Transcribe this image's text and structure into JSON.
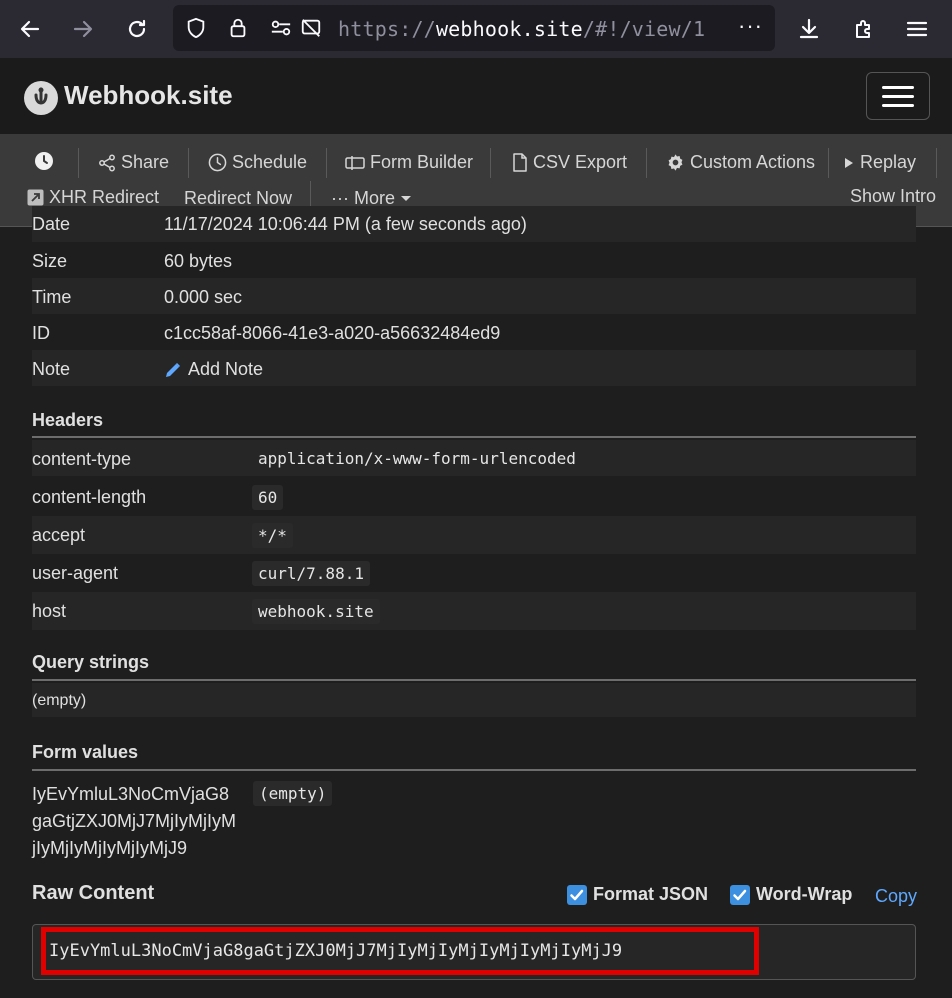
{
  "browser": {
    "url_scheme": "https://",
    "url_host": "webhook.site",
    "url_path": "/#!/view/1"
  },
  "app": {
    "brand": "Webhook.site"
  },
  "toolbar": {
    "share": "Share",
    "schedule": "Schedule",
    "form_builder": "Form Builder",
    "csv_export": "CSV Export",
    "custom_actions": "Custom Actions",
    "replay": "Replay",
    "xhr_redirect": "XHR Redirect",
    "redirect_now": "Redirect Now",
    "more": "More",
    "show_intro": "Show Intro"
  },
  "details": {
    "date_label": "Date",
    "date_value": "11/17/2024 10:06:44 PM (a few seconds ago)",
    "size_label": "Size",
    "size_value": "60 bytes",
    "time_label": "Time",
    "time_value": "0.000 sec",
    "id_label": "ID",
    "id_value": "c1cc58af-8066-41e3-a020-a56632484ed9",
    "note_label": "Note",
    "add_note": "Add Note"
  },
  "headers": {
    "title": "Headers",
    "rows": [
      {
        "key": "content-type",
        "value": "application/x-www-form-urlencoded"
      },
      {
        "key": "content-length",
        "value": "60"
      },
      {
        "key": "accept",
        "value": "*/*"
      },
      {
        "key": "user-agent",
        "value": "curl/7.88.1"
      },
      {
        "key": "host",
        "value": "webhook.site"
      }
    ]
  },
  "query": {
    "title": "Query strings",
    "empty": "(empty)"
  },
  "form": {
    "title": "Form values",
    "key_line1": "IyEvYmluL3NoCmVjaG8",
    "key_line2": "gaGtjZXJ0MjJ7MjIyMjIyM",
    "key_line3": "jIyMjIyMjIyMjIyMjJ9",
    "value": "(empty)"
  },
  "raw": {
    "title": "Raw Content",
    "format_json": "Format JSON",
    "word_wrap": "Word-Wrap",
    "copy": "Copy",
    "content": "IyEvYmluL3NoCmVjaG8gaGtjZXJ0MjJ7MjIyMjIyMjIyMjIyMjIyMjJ9"
  },
  "colors": {
    "accent": "#5ea8ff",
    "highlight": "#e00000",
    "checkbox": "#3d8fe0"
  }
}
